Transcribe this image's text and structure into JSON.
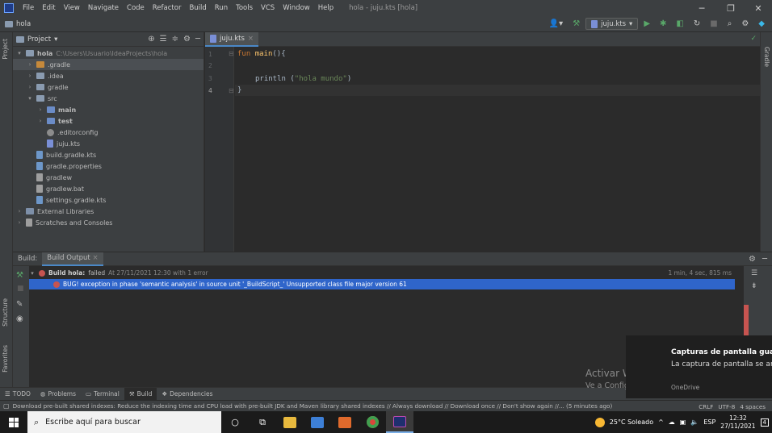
{
  "menubar": {
    "items": [
      "File",
      "Edit",
      "View",
      "Navigate",
      "Code",
      "Refactor",
      "Build",
      "Run",
      "Tools",
      "VCS",
      "Window",
      "Help"
    ],
    "window_title": "hola - juju.kts [hola]"
  },
  "navbar": {
    "breadcrumb": "hola",
    "run_config": "juju.kts"
  },
  "sidebar": {
    "left_tabs": {
      "project": "Project",
      "structure": "Structure",
      "favorites": "Favorites"
    },
    "right_tab": "Gradle"
  },
  "project_panel": {
    "title": "Project",
    "tree": [
      {
        "label": "hola",
        "detail": "C:\\Users\\Usuario\\IdeaProjects\\hola",
        "depth": 0,
        "arrow": "▾",
        "icon": "folder-icon"
      },
      {
        "label": ".gradle",
        "depth": 1,
        "arrow": "›",
        "icon": "folder-orange-icon"
      },
      {
        "label": ".idea",
        "depth": 1,
        "arrow": "›",
        "icon": "folder-icon"
      },
      {
        "label": "gradle",
        "depth": 1,
        "arrow": "›",
        "icon": "folder-icon"
      },
      {
        "label": "src",
        "depth": 1,
        "arrow": "▾",
        "icon": "folder-icon"
      },
      {
        "label": "main",
        "depth": 2,
        "arrow": "›",
        "icon": "folder-blue-icon"
      },
      {
        "label": "test",
        "depth": 2,
        "arrow": "›",
        "icon": "folder-blue-icon"
      },
      {
        "label": ".editorconfig",
        "depth": 2,
        "arrow": "",
        "icon": "gear-icon"
      },
      {
        "label": "juju.kts",
        "depth": 2,
        "arrow": "",
        "icon": "kotlin-script-icon"
      },
      {
        "label": "build.gradle.kts",
        "depth": 1,
        "arrow": "",
        "icon": "gradle-file-icon"
      },
      {
        "label": "gradle.properties",
        "depth": 1,
        "arrow": "",
        "icon": "gradle-file-icon"
      },
      {
        "label": "gradlew",
        "depth": 1,
        "arrow": "",
        "icon": "script-file-icon"
      },
      {
        "label": "gradlew.bat",
        "depth": 1,
        "arrow": "",
        "icon": "script-file-icon"
      },
      {
        "label": "settings.gradle.kts",
        "depth": 1,
        "arrow": "",
        "icon": "gradle-file-icon"
      },
      {
        "label": "External Libraries",
        "depth": 0,
        "arrow": "›",
        "icon": "library-icon"
      },
      {
        "label": "Scratches and Consoles",
        "depth": 0,
        "arrow": "›",
        "icon": "scratches-icon"
      }
    ]
  },
  "editor": {
    "tab": "juju.kts",
    "line_numbers": [
      "1",
      "2",
      "3",
      "4"
    ],
    "code": {
      "l1_kw": "fun",
      "l1_name": "main",
      "l1_rest": "(){",
      "l3_call": "println (",
      "l3_str": "\"hola mundo\"",
      "l3_end": ")",
      "l4": "}"
    }
  },
  "build": {
    "label": "Build:",
    "tab": "Build Output",
    "summary_bold": "Build hola:",
    "summary_status": "failed",
    "summary_detail": "At 27/11/2021 12:30 with 1 error",
    "summary_time": "1 min, 4 sec, 815 ms",
    "error_line": "BUG! exception in phase 'semantic analysis' in source unit '_BuildScript_' Unsupported class file major version 61"
  },
  "toolwindows": [
    {
      "label": "TODO",
      "icon": "list-icon"
    },
    {
      "label": "Problems",
      "icon": "problems-icon"
    },
    {
      "label": "Terminal",
      "icon": "terminal-icon"
    },
    {
      "label": "Build",
      "icon": "hammer-icon"
    },
    {
      "label": "Dependencies",
      "icon": "dependencies-icon"
    }
  ],
  "statusbar": {
    "message": "Download pre-built shared indexes: Reduce the indexing time and CPU load with pre-built JDK and Maven library shared indexes // Always download // Download once // Don't show again //... (5 minutes ago)",
    "line_sep": "CRLF",
    "encoding": "UTF-8",
    "indent": "4 spaces"
  },
  "toast": {
    "title": "Capturas de pantalla guar",
    "body": "La captura de pantalla se ar tu OneDrive.",
    "source": "OneDrive"
  },
  "watermark": {
    "line1": "Activar Windows",
    "line2": "Ve a Configuración para activar Windows."
  },
  "taskbar": {
    "search_placeholder": "Escribe aquí para buscar",
    "weather": "25°C  Soleado",
    "language": "ESP",
    "time": "12:32",
    "date": "27/11/2021",
    "notifications": "4"
  }
}
